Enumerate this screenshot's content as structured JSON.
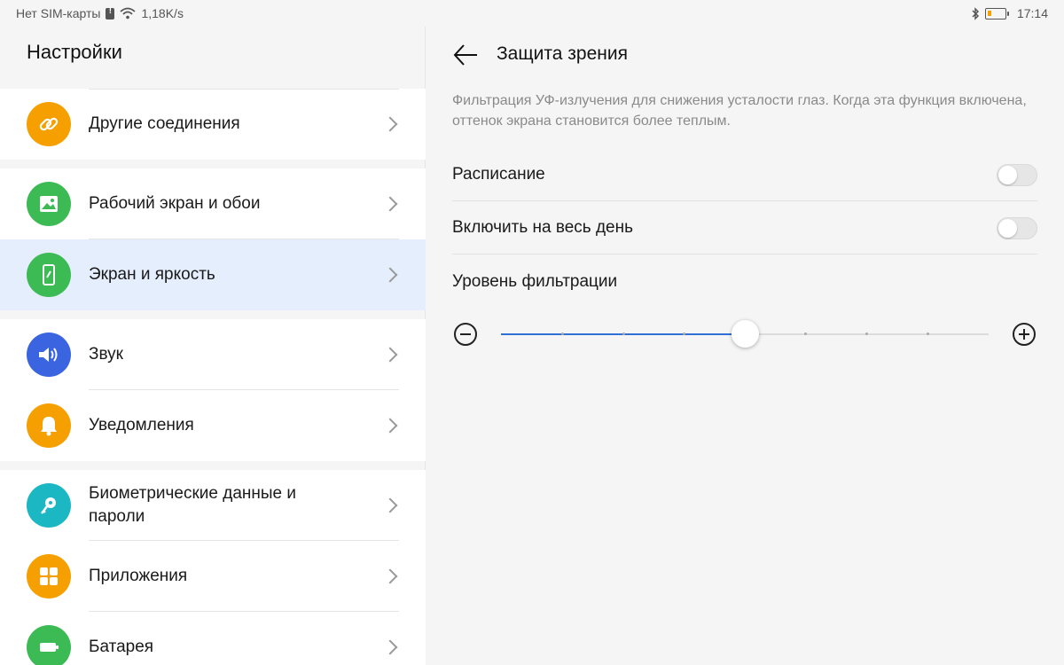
{
  "statusbar": {
    "sim": "Нет SIM-карты",
    "speed": "1,18K/s",
    "time": "17:14"
  },
  "left": {
    "title": "Настройки",
    "items": [
      {
        "label": "Другие соединения",
        "icon": "link-icon",
        "color": "#f5a000"
      },
      {
        "label": "Рабочий экран и обои",
        "icon": "image-icon",
        "color": "#3cba54"
      },
      {
        "label": "Экран и яркость",
        "icon": "phone-brightness-icon",
        "color": "#3cba54"
      },
      {
        "label": "Звук",
        "icon": "speaker-icon",
        "color": "#3a64e0"
      },
      {
        "label": "Уведомления",
        "icon": "bell-icon",
        "color": "#f5a000"
      },
      {
        "label": "Биометрические данные и пароли",
        "icon": "key-icon",
        "color": "#1bb8c4"
      },
      {
        "label": "Приложения",
        "icon": "apps-grid-icon",
        "color": "#f5a000"
      },
      {
        "label": "Батарея",
        "icon": "battery-icon",
        "color": "#3cba54"
      }
    ]
  },
  "right": {
    "title": "Защита зрения",
    "description": "Фильтрация УФ-излучения для снижения усталости глаз. Когда эта функция включена, оттенок экрана становится более теплым.",
    "schedule_label": "Расписание",
    "schedule_on": false,
    "allday_label": "Включить на весь день",
    "allday_on": false,
    "level_label": "Уровень фильтрации",
    "level_fraction": 0.5,
    "accent": "#2f6fd6"
  }
}
